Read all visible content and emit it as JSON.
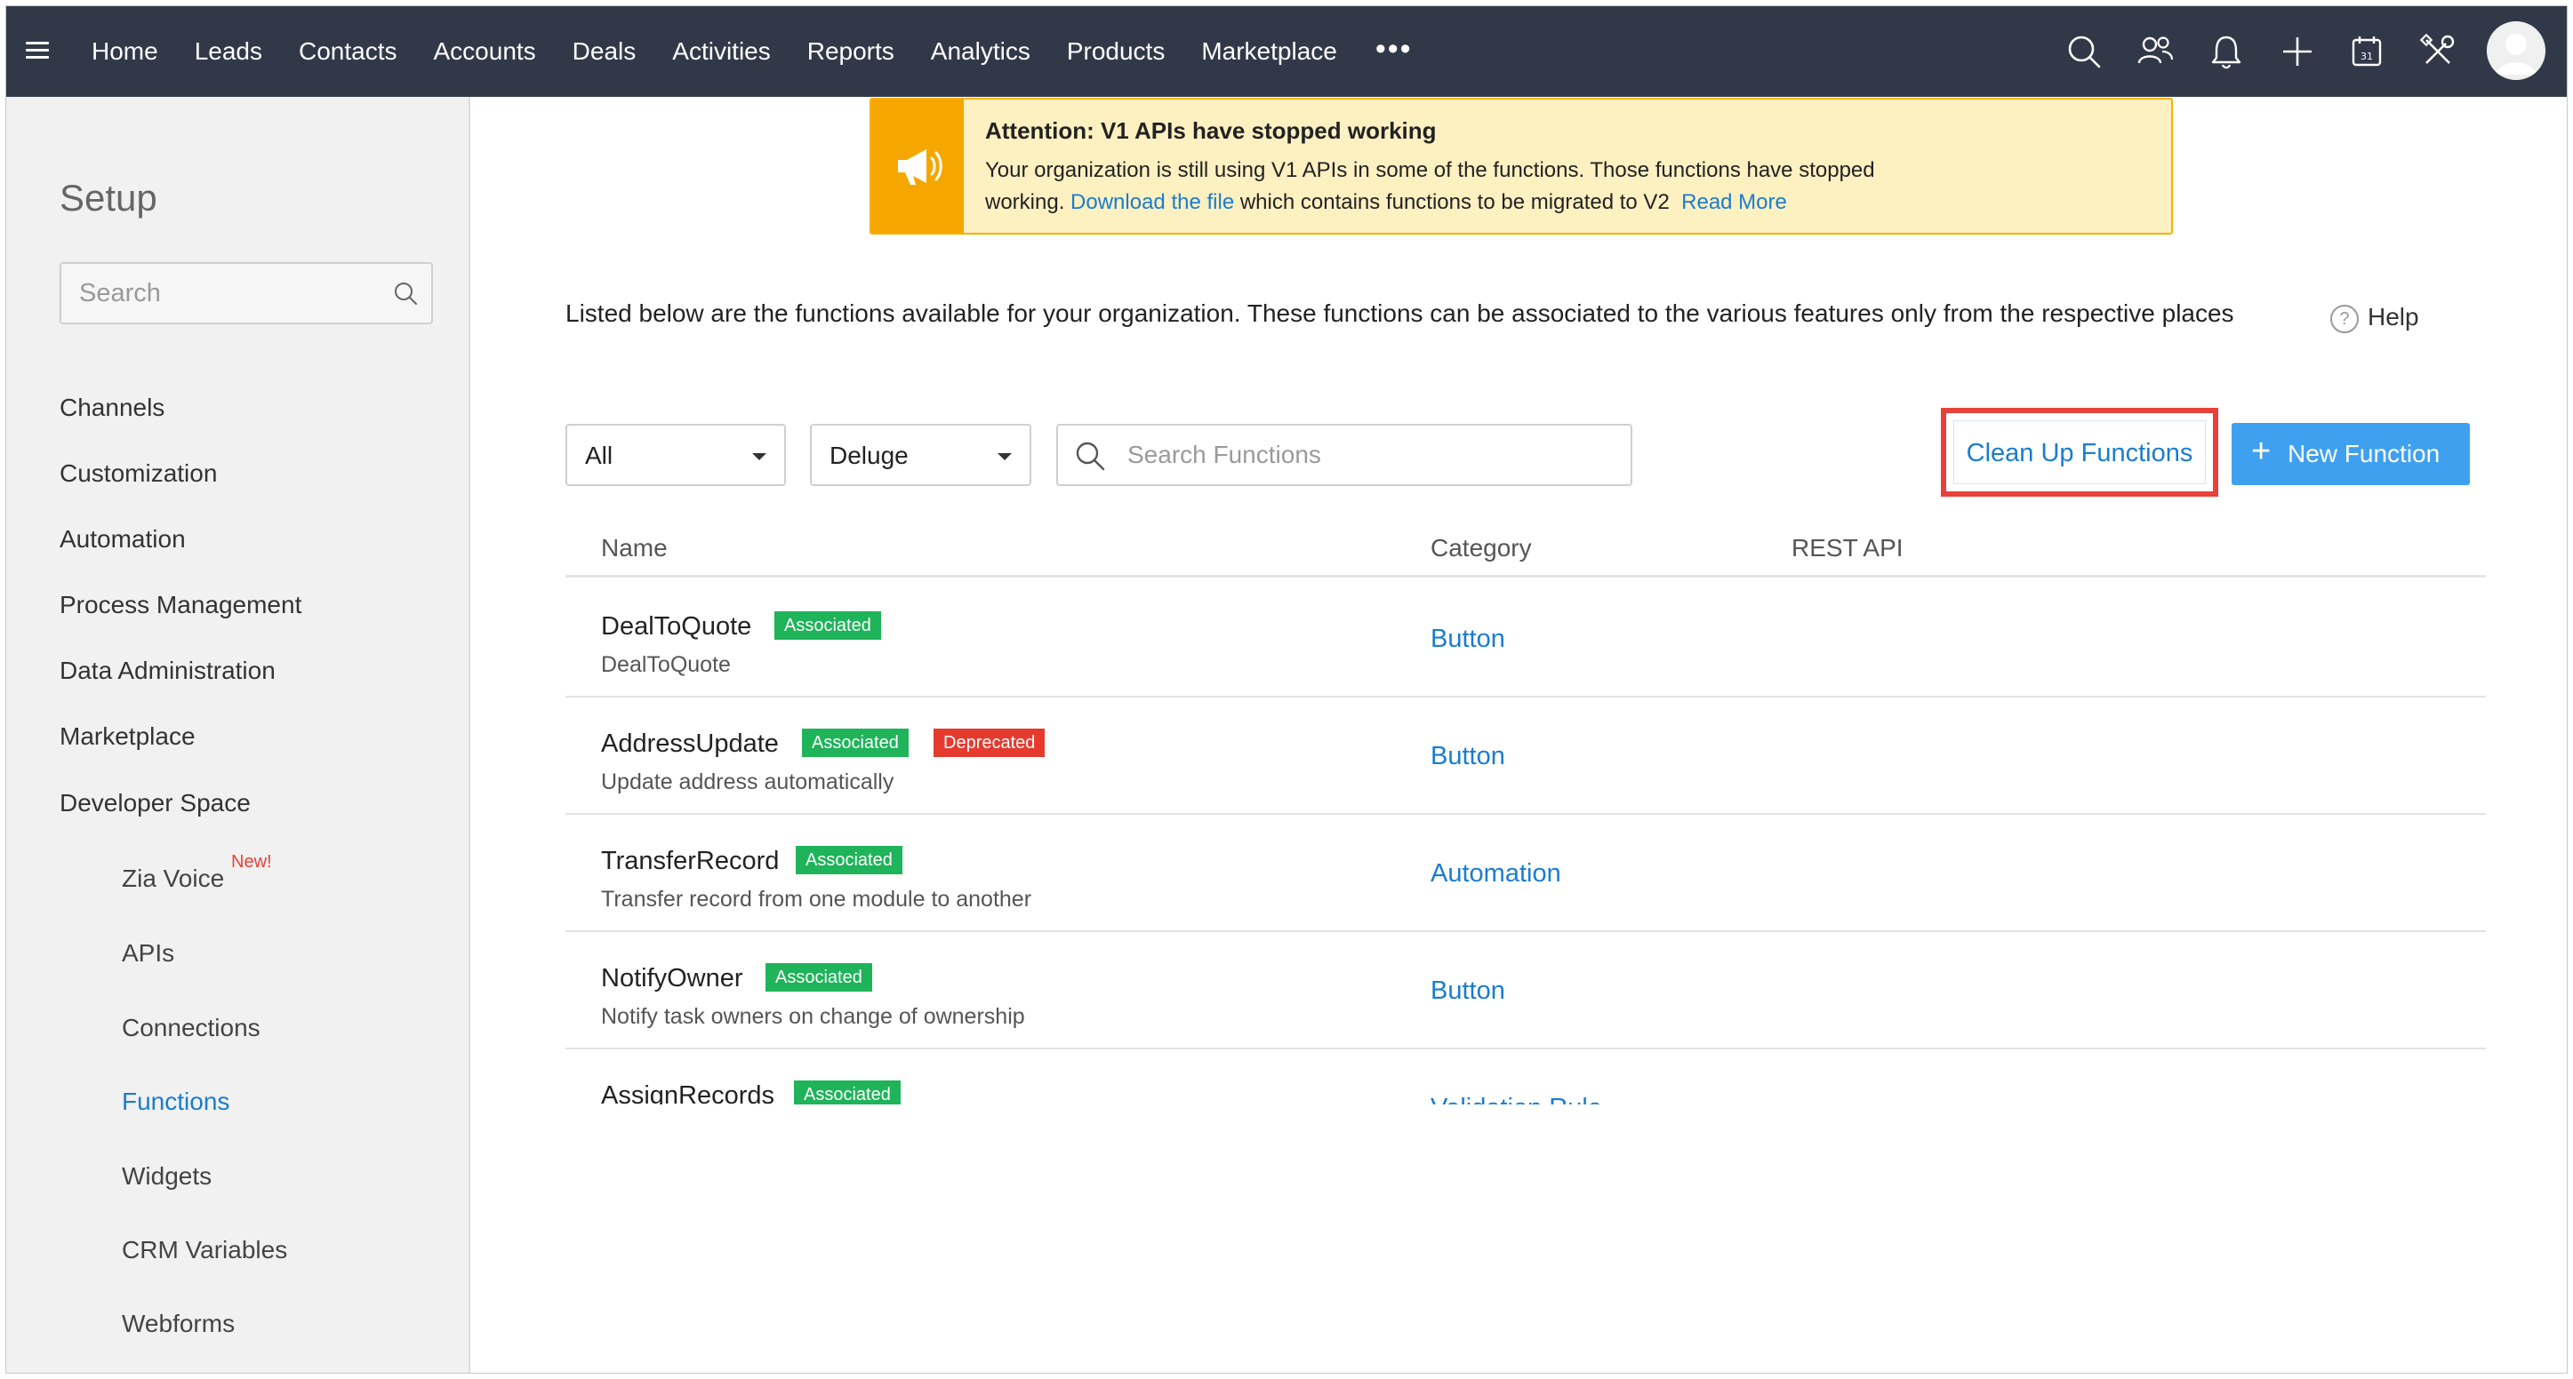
{
  "nav": {
    "tabs": [
      "Home",
      "Leads",
      "Contacts",
      "Accounts",
      "Deals",
      "Activities",
      "Reports",
      "Analytics",
      "Products",
      "Marketplace"
    ],
    "more": "•••"
  },
  "sidebar": {
    "title": "Setup",
    "search_placeholder": "Search",
    "items": [
      "Channels",
      "Customization",
      "Automation",
      "Process Management",
      "Data Administration",
      "Marketplace",
      "Developer Space"
    ],
    "subitems": [
      "Zia Voice",
      "APIs",
      "Connections",
      "Functions",
      "Widgets",
      "CRM Variables",
      "Webforms"
    ],
    "new_badge": "New!",
    "active_subitem": "Functions"
  },
  "banner": {
    "title": "Attention: V1 APIs have stopped working",
    "line1": "Your organization is still using V1 APIs in some of the functions. Those functions have stopped",
    "line2_pre": "working.",
    "line2_link": "Download the file",
    "line2_post": "which contains functions to be migrated to V2",
    "read_more": "Read More"
  },
  "main": {
    "description": "Listed below are the functions available for your organization. These functions can be associated to the various features only from the respective places",
    "help": "Help",
    "filter_all": "All",
    "filter_lang": "Deluge",
    "search_placeholder": "Search Functions",
    "cleanup_button": "Clean Up Functions",
    "new_function_button": "New Function",
    "columns": [
      "Name",
      "Category",
      "REST API"
    ]
  },
  "functions": [
    {
      "name": "DealToQuote",
      "desc": "DealToQuote",
      "badges": [
        "Associated"
      ],
      "category": "Button"
    },
    {
      "name": "AddressUpdate",
      "desc": "Update address automatically",
      "badges": [
        "Associated",
        "Deprecated"
      ],
      "category": "Button"
    },
    {
      "name": "TransferRecord",
      "desc": "Transfer record from one module to another",
      "badges": [
        "Associated"
      ],
      "category": "Automation"
    },
    {
      "name": "NotifyOwner",
      "desc": "Notify task owners on change of ownership",
      "badges": [
        "Associated"
      ],
      "category": "Button"
    },
    {
      "name": "AssignRecords",
      "desc": "",
      "badges": [
        "Associated"
      ],
      "category": "Validation Rule"
    }
  ],
  "colors": {
    "navbar": "#313949",
    "accent": "#1a7cd1",
    "primary_button": "#3fa0f0",
    "associated": "#1fb35a",
    "deprecated": "#e53b2f",
    "banner_bg": "#fdf0c1",
    "banner_strip": "#f5a700",
    "highlight": "#e8413a"
  }
}
